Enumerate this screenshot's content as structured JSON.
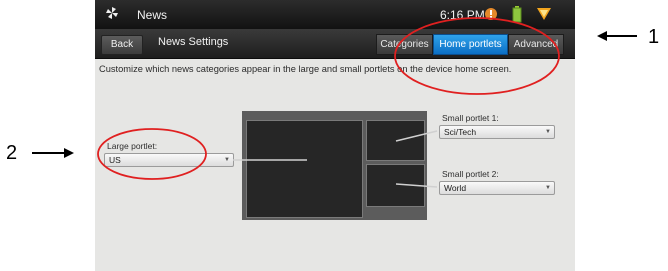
{
  "status_bar": {
    "app_name": "News",
    "time": "6:16 PM"
  },
  "action_bar": {
    "back_label": "Back",
    "title": "News Settings",
    "tabs": [
      {
        "label": "Categories",
        "active": false
      },
      {
        "label": "Home portlets",
        "active": true
      },
      {
        "label": "Advanced",
        "active": false
      }
    ]
  },
  "description": "Customize which news categories appear in the large and small portlets on the device home screen.",
  "large_portlet": {
    "label": "Large portlet:",
    "value": "US"
  },
  "small_portlet_1": {
    "label": "Small portlet 1:",
    "value": "Sci/Tech"
  },
  "small_portlet_2": {
    "label": "Small portlet 2:",
    "value": "World"
  },
  "annotations": {
    "right_marker": "1",
    "left_marker": "2"
  },
  "colors": {
    "active_tab": "#1a86da",
    "highlight_circle": "#e02020",
    "screen_background": "#e6e6e4"
  },
  "icons": [
    "app-pinwheel-icon",
    "notification-alert-icon",
    "battery-icon",
    "signal-icon",
    "arrow-icon"
  ]
}
